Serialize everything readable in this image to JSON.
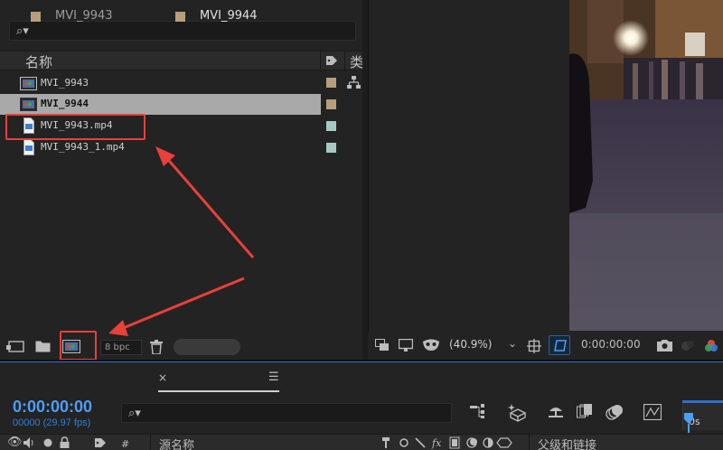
{
  "project": {
    "columns": {
      "name": "名称",
      "type": "类"
    },
    "items": [
      {
        "label": "MVI_9943",
        "kind": "composition",
        "swatch": "#b69f7a"
      },
      {
        "label": "MVI_9944",
        "kind": "composition",
        "swatch": "#b69f7a",
        "selected": true
      },
      {
        "label": "MVI_9943.mp4",
        "kind": "footage",
        "swatch": "#a4c9c4"
      },
      {
        "label": "MVI_9943_1.mp4",
        "kind": "footage",
        "swatch": "#a4c9c4"
      }
    ],
    "footer": {
      "bpc": "8 bpc"
    }
  },
  "viewer": {
    "zoom": "(40.9%)",
    "timecode": "0:00:00:00"
  },
  "timeline": {
    "tabs": [
      {
        "label": "MVI_9943"
      },
      {
        "label": "MVI_9944",
        "active": true
      }
    ],
    "close_glyph": "×",
    "menu_glyph": "☰",
    "timecode": "0:00:00:00",
    "frames": "00000 (29.97 fps)",
    "ruler_label": "0s",
    "layer_headers": {
      "number": "#",
      "source_name": "源名称",
      "parent": "父级和链接"
    }
  },
  "colors": {
    "accent": "#2e6fd1",
    "timecode": "#4d9ef5",
    "annotation": "#e8403a"
  }
}
